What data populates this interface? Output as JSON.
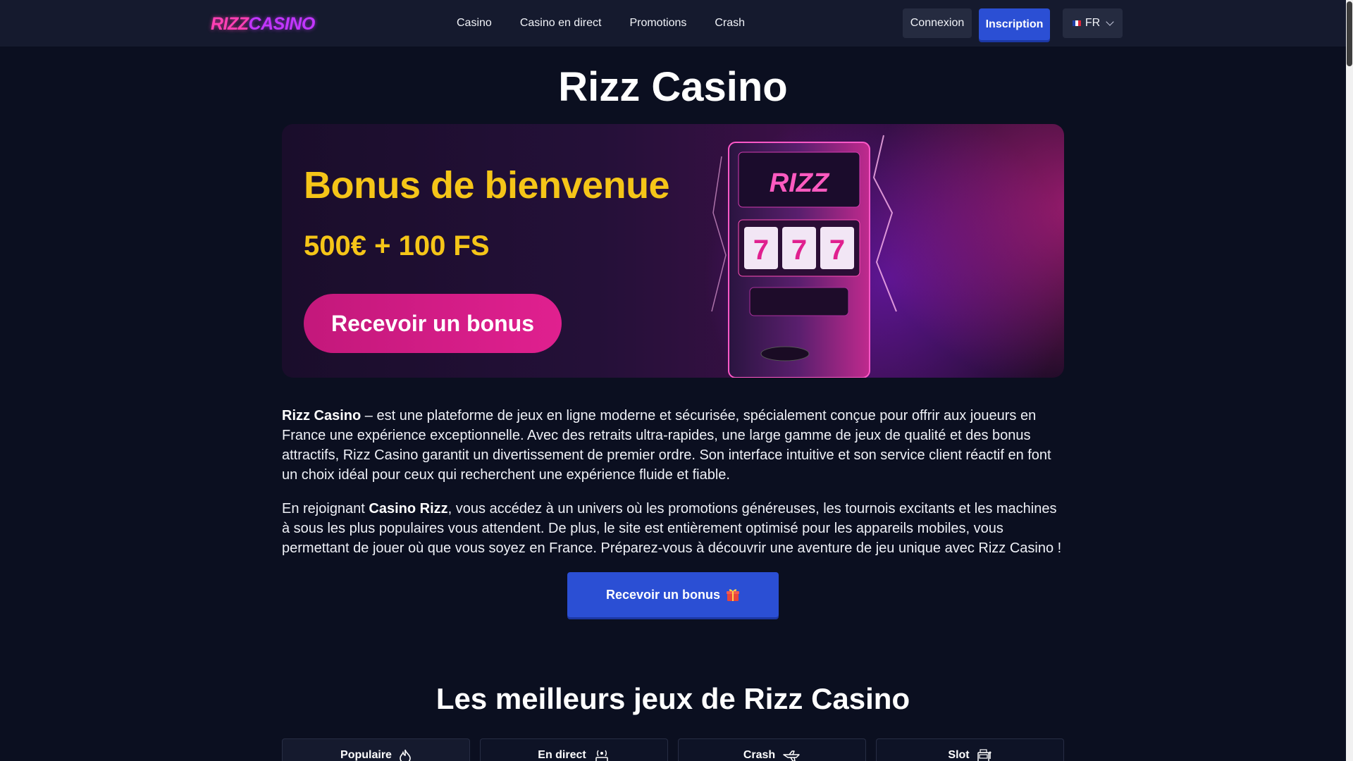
{
  "header": {
    "logo": {
      "part1": "RIZZ",
      "part2": "CASINO"
    },
    "nav": [
      "Casino",
      "Casino en direct",
      "Promotions",
      "Crash"
    ],
    "login_label": "Connexion",
    "signup_label": "Inscription",
    "language": "FR"
  },
  "main": {
    "title": "Rizz Casino",
    "banner": {
      "title": "Bonus de bienvenue",
      "subtitle": "500€ + 100 FS",
      "button_label": "Recevoir un bonus",
      "machine_brand": "RIZZ",
      "machine_reels": [
        "7",
        "7",
        "7"
      ]
    },
    "paragraph1": {
      "bold": "Rizz Casino",
      "text": " – est une plateforme de jeux en ligne moderne et sécurisée, spécialement conçue pour offrir aux joueurs en France une expérience exceptionnelle. Avec des retraits ultra-rapides, une large gamme de jeux de qualité et des bonus attractifs, Rizz Casino garantit un divertissement de premier ordre. Son interface intuitive et son service client réactif en font un choix idéal pour ceux qui recherchent une expérience fluide et fiable."
    },
    "paragraph2": {
      "prefix": "En rejoignant ",
      "bold": "Casino Rizz",
      "text": ", vous accédez à un univers où les promotions généreuses, les tournois excitants et les machines à sous les plus populaires vous attendent. De plus, le site est entièrement optimisé pour les appareils mobiles, vous permettant de jouer où que vous soyez en France. Préparez-vous à découvrir une aventure de jeu unique avec Rizz Casino !"
    },
    "cta_label": "Recevoir un bonus",
    "games_title": "Les meilleurs jeux de Rizz Casino",
    "tabs": [
      {
        "label": "Populaire",
        "icon": "flame-icon"
      },
      {
        "label": "En direct",
        "icon": "live-broadcast-icon"
      },
      {
        "label": "Crash",
        "icon": "airplane-icon"
      },
      {
        "label": "Slot",
        "icon": "slot-machine-icon"
      }
    ]
  },
  "colors": {
    "background": "#0b0f20",
    "header": "#151a2e",
    "primary_button": "#2b4fd4",
    "banner_yellow": "#f5c518",
    "banner_pink": "#e0208f"
  }
}
